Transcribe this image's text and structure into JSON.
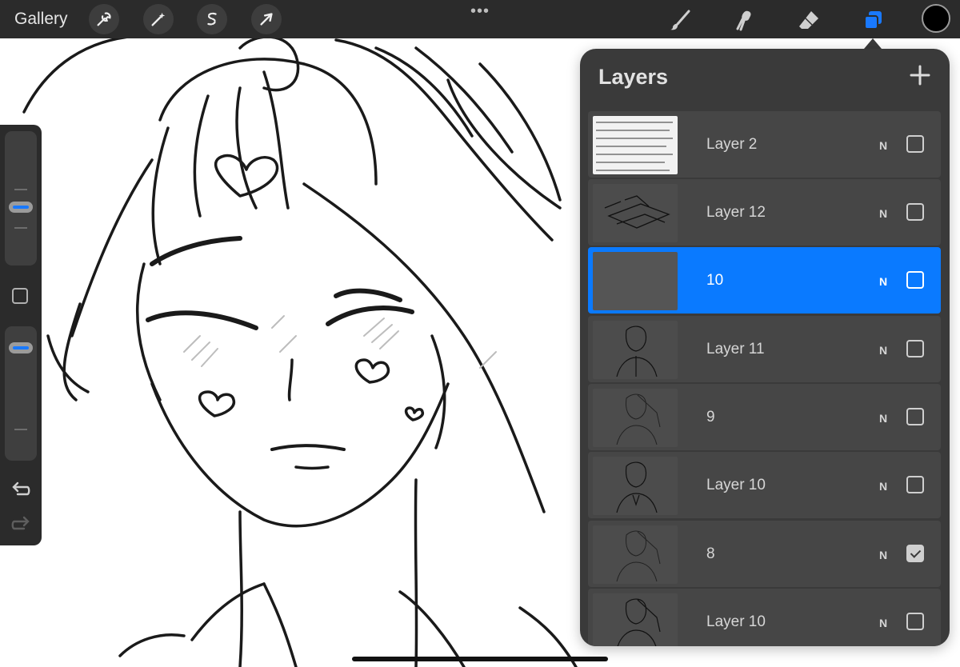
{
  "topbar": {
    "gallery_label": "Gallery",
    "left_tools": [
      "wrench-icon",
      "magic-wand-icon",
      "selection-icon",
      "move-arrow-icon"
    ],
    "right_tools": [
      "brush-icon",
      "smudge-icon",
      "eraser-icon",
      "layers-icon"
    ],
    "accent_color": "#1979ff",
    "current_color": "#000000"
  },
  "sidebar": {
    "brush_size_level": 0.6,
    "opacity_level": 0.85,
    "icons": [
      "modify-icon",
      "undo-icon",
      "redo-icon"
    ]
  },
  "layers_panel": {
    "title": "Layers",
    "add_icon": "plus-icon",
    "layers": [
      {
        "name": "Layer 2",
        "blend": "N",
        "visible": false,
        "selected": false
      },
      {
        "name": "Layer 12",
        "blend": "N",
        "visible": false,
        "selected": false
      },
      {
        "name": "10",
        "blend": "N",
        "visible": false,
        "selected": true
      },
      {
        "name": "Layer 11",
        "blend": "N",
        "visible": false,
        "selected": false
      },
      {
        "name": "9",
        "blend": "N",
        "visible": false,
        "selected": false
      },
      {
        "name": "Layer 10",
        "blend": "N",
        "visible": false,
        "selected": false
      },
      {
        "name": "8",
        "blend": "N",
        "visible": true,
        "selected": false
      },
      {
        "name": "Layer 10",
        "blend": "N",
        "visible": false,
        "selected": false
      }
    ]
  }
}
